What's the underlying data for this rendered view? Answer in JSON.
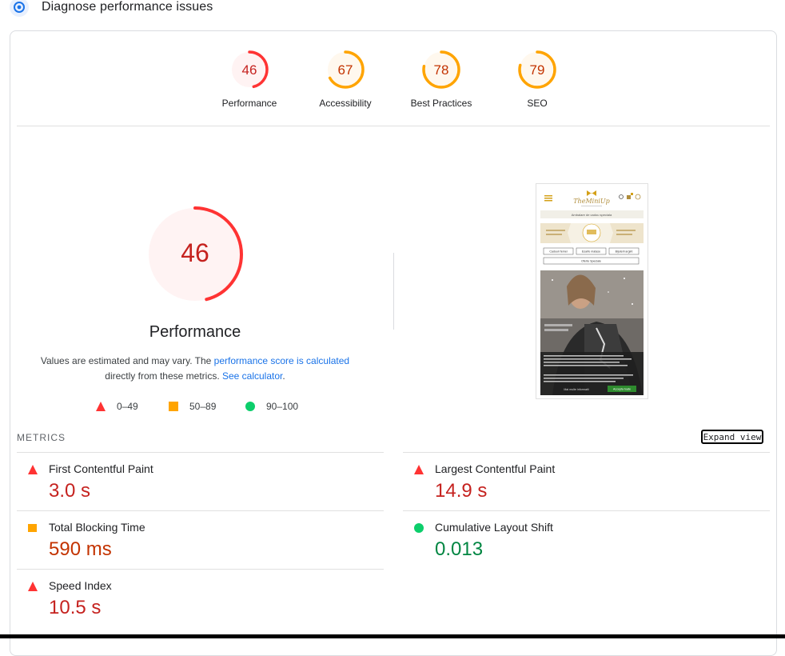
{
  "header": {
    "title": "Diagnose performance issues"
  },
  "colors": {
    "fail": "#ff3333",
    "fail_text": "#c5221f",
    "average": "#ffa400",
    "average_text": "#c33300",
    "pass": "#0cce6b",
    "pass_text": "#018642",
    "link": "#1a73e8"
  },
  "scores": [
    {
      "label": "Performance",
      "value": 46,
      "rating": "fail"
    },
    {
      "label": "Accessibility",
      "value": 67,
      "rating": "average"
    },
    {
      "label": "Best Practices",
      "value": 78,
      "rating": "average"
    },
    {
      "label": "SEO",
      "value": 79,
      "rating": "average"
    }
  ],
  "performance": {
    "score": "46",
    "title": "Performance",
    "desc_prefix": "Values are estimated and may vary. The ",
    "desc_link1": "performance score is calculated",
    "desc_middle": "directly from these metrics. ",
    "desc_link2": "See calculator",
    "desc_suffix": "."
  },
  "legend": [
    {
      "shape": "triangle",
      "range": "0–49"
    },
    {
      "shape": "square",
      "range": "50–89"
    },
    {
      "shape": "circle",
      "range": "90–100"
    }
  ],
  "metrics_section": {
    "title": "METRICS",
    "expand_label": "Expand view",
    "items": [
      {
        "name": "First Contentful Paint",
        "value": "3.0 s",
        "rating": "fail"
      },
      {
        "name": "Largest Contentful Paint",
        "value": "14.9 s",
        "rating": "fail"
      },
      {
        "name": "Total Blocking Time",
        "value": "590 ms",
        "rating": "average"
      },
      {
        "name": "Cumulative Layout Shift",
        "value": "0.013",
        "rating": "pass"
      },
      {
        "name": "Speed Index",
        "value": "10.5 s",
        "rating": "fail"
      }
    ]
  },
  "screenshot": {
    "brand": "TheMiniUp",
    "announcement": "Ambalare de cadou speciala",
    "buttons": [
      "Cadouri femei",
      "Esarfe matase",
      "Bijuterii argint",
      "Oferte Speciale"
    ],
    "cookie_more": "Mai multe informatii",
    "cookie_accept": "Accepta toate"
  }
}
